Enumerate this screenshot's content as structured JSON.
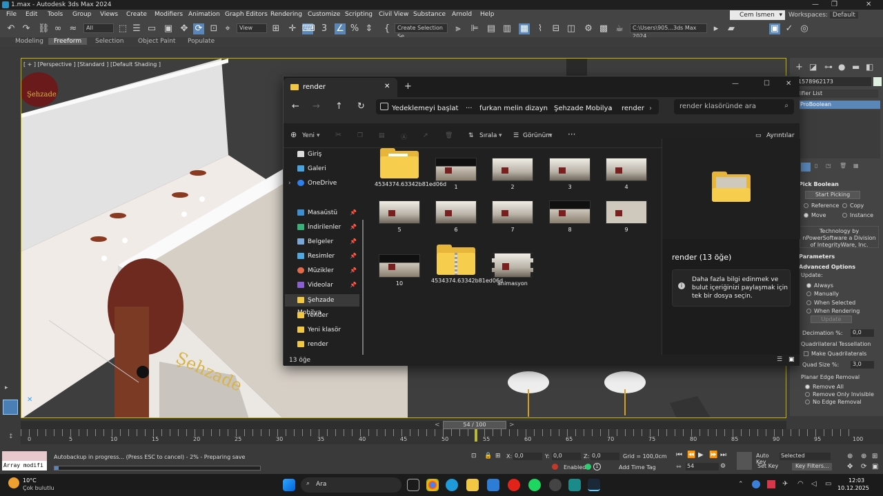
{
  "app": {
    "title": "1.max - Autodesk 3ds Max 2024",
    "menu": [
      "File",
      "Edit",
      "Tools",
      "Group",
      "Views",
      "Create",
      "Modifiers",
      "Animation",
      "Graph Editors",
      "Rendering",
      "Customize",
      "Scripting",
      "Civil View",
      "Substance",
      "Arnold",
      "Help"
    ],
    "user": "Cem Ismen",
    "workspace_label": "Workspaces:",
    "workspace_value": "Default",
    "toolbar": {
      "filter": "All",
      "view": "View",
      "selection_set": "Create Selection Se",
      "path": "C:\\Users\\905...3ds Max 2024"
    },
    "ribbon_tabs": [
      "Modeling",
      "Freeform",
      "Selection",
      "Object Paint",
      "Populate"
    ],
    "viewport_label": "[ + ] [Perspective ] [Standard ] [Default Shading ]",
    "timeline_counter": "54 / 100",
    "ruler_ticks": [
      "0",
      "5",
      "10",
      "15",
      "20",
      "25",
      "30",
      "35",
      "40",
      "45",
      "50",
      "55",
      "60",
      "65",
      "70",
      "75",
      "80",
      "85",
      "90",
      "95",
      "100"
    ]
  },
  "command_panel": {
    "object_name": "1578962173",
    "modifier_list": "difier List",
    "stack_item": "ProBoolean",
    "pick_boolean_title": "Pick Boolean",
    "start_picking": "Start Picking",
    "radios": [
      "Reference",
      "Copy",
      "Move",
      "Instance"
    ],
    "tech_note": "Technology by nPowerSoftware a Division of IntegrityWare, Inc.",
    "parameters_title": "Parameters",
    "advanced_title": "Advanced Options",
    "update_label": "Update:",
    "update_options": [
      "Always",
      "Manually",
      "When Selected",
      "When Rendering"
    ],
    "update_button": "Update",
    "decimation_label": "Decimation %:",
    "decimation_value": "0,0",
    "quad_title": "Quadrilateral Tessellation",
    "make_quads": "Make Quadrilaterals",
    "quad_size_label": "Quad Size %:",
    "quad_size_value": "3,0",
    "planar_title": "Planar Edge Removal",
    "planar_options": [
      "Remove All",
      "Remove Only Invisible",
      "No Edge Removal"
    ]
  },
  "explorer": {
    "tab_title": "render",
    "breadcrumb": [
      "Yedeklemeyi başlat",
      "furkan melin dizayn",
      "Şehzade Mobilya",
      "render"
    ],
    "search_placeholder": "render klasöründe ara",
    "commands": {
      "new": "Yeni",
      "sort": "Sırala",
      "view": "Görünüm",
      "details": "Ayrıntılar"
    },
    "sidebar": [
      "Giriş",
      "Galeri",
      "OneDrive",
      "Masaüstü",
      "İndirilenler",
      "Belgeler",
      "Resimler",
      "Müzikler",
      "Videolar",
      "Şehzade Mobilya",
      "render",
      "Yeni klasör",
      "render"
    ],
    "items": [
      {
        "name": "4534374.63342b81ed06d",
        "type": "folder"
      },
      {
        "name": "1",
        "type": "image"
      },
      {
        "name": "2",
        "type": "image"
      },
      {
        "name": "3",
        "type": "image"
      },
      {
        "name": "4",
        "type": "image"
      },
      {
        "name": "5",
        "type": "image"
      },
      {
        "name": "6",
        "type": "image"
      },
      {
        "name": "7",
        "type": "image"
      },
      {
        "name": "8",
        "type": "image"
      },
      {
        "name": "9",
        "type": "plan"
      },
      {
        "name": "10",
        "type": "image"
      },
      {
        "name": "4534374.63342b81ed06d",
        "type": "zip"
      },
      {
        "name": "animasyon",
        "type": "video"
      }
    ],
    "pane_title": "render (13 öğe)",
    "pane_info": "Daha fazla bilgi edinmek ve bulut içeriğinizi paylaşmak için tek bir dosya seçin.",
    "status": "13 öğe"
  },
  "status": {
    "script_field": "Array modifi",
    "autobackup": "Autobackup in progress... (Press ESC to cancel)  -  2%  -  Preparing save",
    "x_label": "X:",
    "x": "0,0",
    "y_label": "Y:",
    "y": "0,0",
    "z_label": "Z:",
    "z": "0,0",
    "grid": "Grid = 100,0cm",
    "enabled": "Enabled:",
    "add_time_tag": "Add Time Tag",
    "frame": "54",
    "auto_key": "Auto Key",
    "selected": "Selected",
    "set_key": "Set Key",
    "key_filters": "Key Filters..."
  },
  "taskbar": {
    "weather_temp": "10°C",
    "weather_desc": "Çok bulutlu",
    "search": "Ara",
    "time": "12:03",
    "date": "10.12.2025"
  }
}
